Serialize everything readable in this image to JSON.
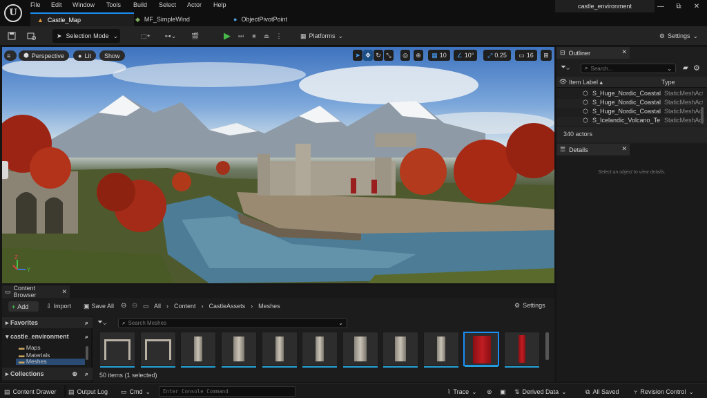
{
  "titlebar": {
    "menus": [
      "File",
      "Edit",
      "Window",
      "Tools",
      "Build",
      "Select",
      "Actor",
      "Help"
    ],
    "project_name": "castle_environment",
    "tabs": [
      {
        "label": "Castle_Map",
        "icon": "level-icon"
      },
      {
        "label": "MF_SimpleWind",
        "icon": "material-function-icon"
      },
      {
        "label": "ObjectPivotPoint",
        "icon": "material-icon"
      }
    ],
    "window_controls": {
      "minimize": "—",
      "restore": "⧉",
      "close": "✕"
    }
  },
  "toolbar": {
    "selection_mode": "Selection Mode",
    "platforms": "Platforms",
    "settings": "Settings"
  },
  "viewport": {
    "perspective": "Perspective",
    "lit": "Lit",
    "show": "Show",
    "grid_snap": "10",
    "rotation_snap": "10°",
    "scale_snap": "0.25",
    "camera_speed": "16",
    "axis_z": "Z",
    "axis_y": "Y"
  },
  "outliner": {
    "tab_label": "Outliner",
    "search_placeholder": "Search...",
    "col_label": "Item Label ▴",
    "col_type": "Type",
    "rows": [
      {
        "label": "S_Huge_Nordic_Coastal",
        "type": "StaticMeshActor"
      },
      {
        "label": "S_Huge_Nordic_Coastal",
        "type": "StaticMeshActor"
      },
      {
        "label": "S_Huge_Nordic_Coastal",
        "type": "StaticMeshActor"
      },
      {
        "label": "S_Icelandic_Volcano_Te",
        "type": "StaticMeshActor"
      }
    ],
    "count": "340 actors"
  },
  "details": {
    "tab_label": "Details",
    "empty_message": "Select an object to view details."
  },
  "content_browser": {
    "tab_label": "Content Browser",
    "add": "Add",
    "import": "Import",
    "save_all": "Save All",
    "breadcrumb": [
      "All",
      "Content",
      "CastleAssets",
      "Meshes"
    ],
    "settings": "Settings",
    "favorites": "Favorites",
    "project": "castle_environment",
    "folders": [
      "Maps",
      "Materials",
      "Meshes"
    ],
    "collections": "Collections",
    "search_placeholder": "Search Meshes",
    "item_count": "50 items (1 selected)",
    "assets": [
      {
        "kind": "arch"
      },
      {
        "kind": "arch"
      },
      {
        "kind": "pillar"
      },
      {
        "kind": "pillar"
      },
      {
        "kind": "pillar"
      },
      {
        "kind": "pillar"
      },
      {
        "kind": "pillar"
      },
      {
        "kind": "pillar"
      },
      {
        "kind": "pillar"
      },
      {
        "kind": "banner",
        "selected": true
      },
      {
        "kind": "banner"
      }
    ]
  },
  "statusbar": {
    "content_drawer": "Content Drawer",
    "output_log": "Output Log",
    "cmd": "Cmd",
    "console_placeholder": "Enter Console Command",
    "trace": "Trace",
    "derived_data": "Derived Data",
    "all_saved": "All Saved",
    "revision_control": "Revision Control"
  },
  "colors": {
    "accent_blue": "#1b8ef6",
    "play_green": "#47b84a",
    "asset_bar": "#25a3d9"
  }
}
